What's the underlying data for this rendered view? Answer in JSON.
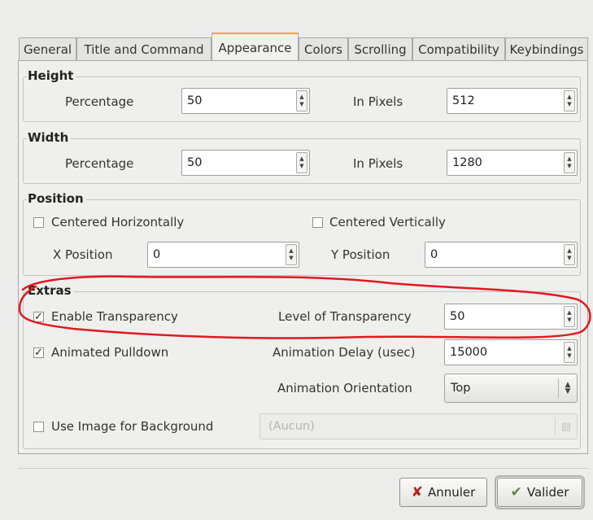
{
  "tabs": [
    {
      "label": "General"
    },
    {
      "label": "Title and Command"
    },
    {
      "label": "Appearance",
      "active": true
    },
    {
      "label": "Colors"
    },
    {
      "label": "Scrolling"
    },
    {
      "label": "Compatibility"
    },
    {
      "label": "Keybindings"
    }
  ],
  "height": {
    "title": "Height",
    "percentage_label": "Percentage",
    "percentage_value": "50",
    "pixels_label": "In Pixels",
    "pixels_value": "512"
  },
  "width": {
    "title": "Width",
    "percentage_label": "Percentage",
    "percentage_value": "50",
    "pixels_label": "In Pixels",
    "pixels_value": "1280"
  },
  "position": {
    "title": "Position",
    "center_h_label": "Centered Horizontally",
    "center_h_checked": false,
    "center_v_label": "Centered Vertically",
    "center_v_checked": false,
    "x_label": "X Position",
    "x_value": "0",
    "y_label": "Y Position",
    "y_value": "0"
  },
  "extras": {
    "title": "Extras",
    "transparency_label": "Enable Transparency",
    "transparency_checked": true,
    "transparency_level_label": "Level of Transparency",
    "transparency_level_value": "50",
    "pulldown_label": "Animated Pulldown",
    "pulldown_checked": true,
    "delay_label": "Animation Delay (usec)",
    "delay_value": "15000",
    "orientation_label": "Animation Orientation",
    "orientation_value": "Top",
    "bgimage_label": "Use Image for Background",
    "bgimage_checked": false,
    "bgimage_value": "(Aucun)"
  },
  "buttons": {
    "cancel_label": "Annuler",
    "ok_label": "Valider"
  },
  "colors": {
    "annotation": "#e0191e",
    "active_tab_accent": "#e8a83a",
    "cancel_icon": "#b0241c",
    "ok_icon": "#5b8a3a"
  },
  "icons": {
    "cancel": "x-mark-icon",
    "ok": "checkmark-icon",
    "file": "folder-icon"
  }
}
